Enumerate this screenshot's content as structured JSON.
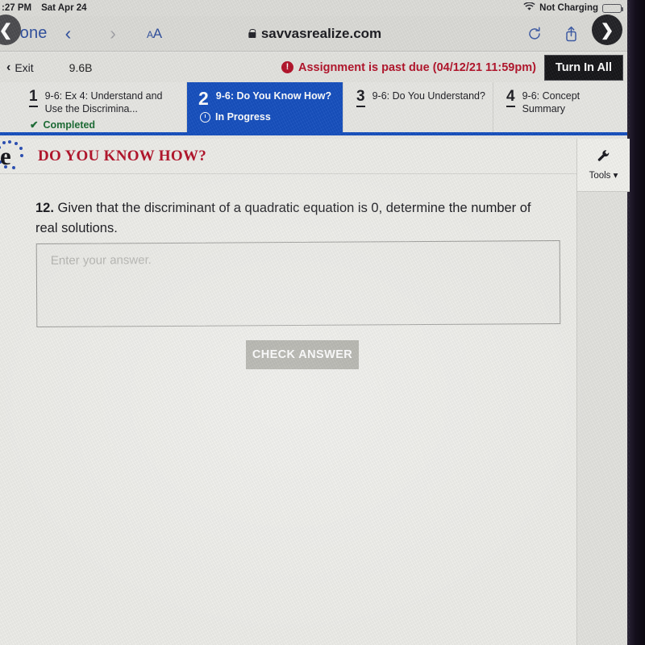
{
  "status_bar": {
    "time": ":27 PM",
    "date": "Sat Apr 24",
    "wifi_icon": "wifi-icon",
    "battery_text": "Not Charging",
    "battery_icon": "battery-icon"
  },
  "browser": {
    "done_label": "Done",
    "back_icon": "chevron-left-icon",
    "forward_icon": "chevron-right-icon",
    "text_size_label": "AA",
    "lock_icon": "lock-icon",
    "url": "savvasrealize.com",
    "reload_icon": "reload-icon",
    "share_icon": "share-icon",
    "compass_icon": "compass-icon"
  },
  "app_bar": {
    "exit_icon": "chevron-left-icon",
    "exit_label": "Exit",
    "lesson_code": "9.6B",
    "alert_icon": "alert-circle-icon",
    "due_message": "Assignment is past due (04/12/21 11:59pm)",
    "turn_in_label": "Turn In All",
    "due_color": "#b3132a",
    "turn_in_bg": "#16161a"
  },
  "steps": {
    "prev_icon": "nav-prev-icon",
    "next_icon": "nav-next-icon",
    "active_color": "#1650bf",
    "items": [
      {
        "number": "1",
        "title": "9-6: Ex 4: Understand and Use the Discrimina...",
        "status": "Completed",
        "status_icon": "check-icon"
      },
      {
        "number": "2",
        "title": "9-6: Do You Know How?",
        "status": "In Progress",
        "status_icon": "clock-icon"
      },
      {
        "number": "3",
        "title": "9-6: Do You Understand?",
        "status": "",
        "status_icon": ""
      },
      {
        "number": "4",
        "title": "9-6: Concept Summary",
        "status": "",
        "status_icon": ""
      }
    ]
  },
  "section": {
    "logo_letter": "e",
    "title": "DO YOU KNOW HOW?",
    "title_color": "#b3132a",
    "check_icon": "check-icon",
    "tools_icon": "wrench-icon",
    "tools_label": "Tools ▾"
  },
  "exercise": {
    "number": "12.",
    "question": " Given that the discriminant of a quadratic equation is 0, determine the number of real solutions.",
    "answer_value": "",
    "answer_placeholder": "Enter your answer.",
    "check_button_label": "CHECK ANSWER",
    "check_button_bg": "#a8a8a0"
  }
}
